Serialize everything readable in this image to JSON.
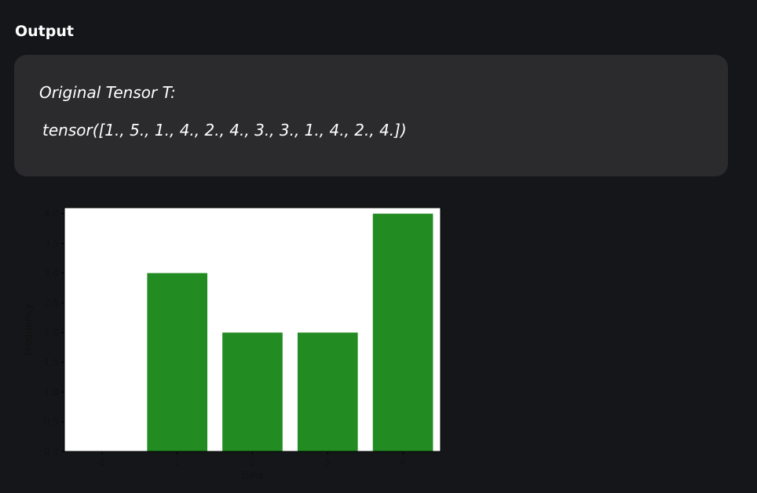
{
  "section": {
    "title": "Output"
  },
  "output": {
    "line1": "Original Tensor T:",
    "line2": "tensor([1., 5., 1., 4., 2., 4., 3., 3., 1., 4., 2., 4.])"
  },
  "chart_data": {
    "type": "bar",
    "categories": [
      "0",
      "1",
      "2",
      "3",
      "4"
    ],
    "values": [
      0,
      3,
      2,
      2,
      4
    ],
    "x": [
      0,
      1,
      2,
      3,
      4
    ],
    "xlabel": "Bins",
    "ylabel": "Frequency",
    "ylim": [
      0,
      4.1
    ],
    "xlim": [
      -0.5,
      4.5
    ],
    "yticks": [
      "0.0",
      "0.5",
      "1.0",
      "1.5",
      "2.0",
      "2.5",
      "3.0",
      "3.5",
      "4.0"
    ],
    "ytick_values": [
      0,
      0.5,
      1.0,
      1.5,
      2.0,
      2.5,
      3.0,
      3.5,
      4.0
    ],
    "grid": false,
    "colors": {
      "bar": "#228b22",
      "plot_background": "#ffffff"
    }
  }
}
